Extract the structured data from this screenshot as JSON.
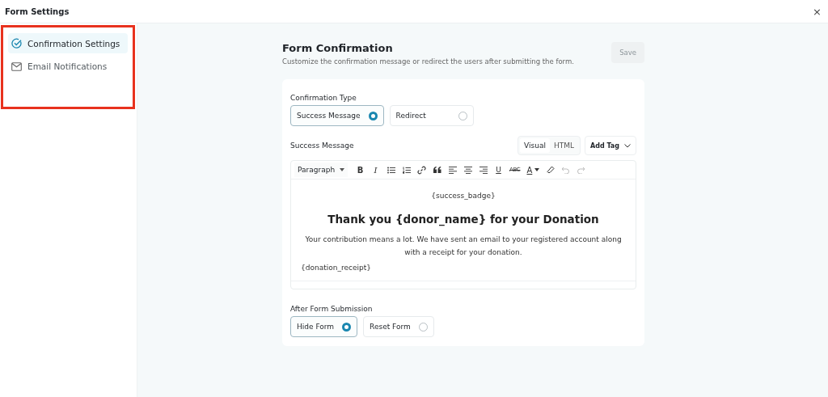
{
  "window": {
    "title": "Form Settings",
    "close": "×"
  },
  "sidebar": {
    "highlighted": true,
    "items": [
      {
        "kind": "confirmation",
        "label": "Confirmation Settings",
        "selected": true
      },
      {
        "kind": "email",
        "label": "Email Notifications",
        "selected": false
      }
    ]
  },
  "main": {
    "heading": "Form Confirmation",
    "description": "Customize the confirmation message or redirect the users after submitting the form.",
    "save": {
      "label": "Save",
      "disabled": true
    }
  },
  "confirmation_type": {
    "label": "Confirmation Type",
    "options": [
      {
        "label": "Success Message",
        "selected": true
      },
      {
        "label": "Redirect",
        "selected": false
      }
    ]
  },
  "success_message": {
    "label": "Success Message",
    "modes": [
      {
        "label": "Visual",
        "selected": true
      },
      {
        "label": "HTML",
        "selected": false
      }
    ],
    "add_tag": "Add Tag",
    "toolbar": {
      "format": "Paragraph",
      "tools": [
        {
          "kind": "bold",
          "label": "B",
          "disabled": false
        },
        {
          "kind": "italic",
          "label": "I",
          "disabled": false
        },
        {
          "kind": "bullets",
          "disabled": false
        },
        {
          "kind": "numbers",
          "disabled": false
        },
        {
          "kind": "link",
          "disabled": false
        },
        {
          "kind": "quote",
          "disabled": false
        },
        {
          "kind": "align-left",
          "disabled": false
        },
        {
          "kind": "align-center",
          "disabled": false
        },
        {
          "kind": "align-right",
          "disabled": false
        },
        {
          "kind": "underline",
          "label": "U",
          "disabled": false
        },
        {
          "kind": "strike",
          "label": "ABC",
          "disabled": false
        },
        {
          "kind": "color",
          "label": "A",
          "disabled": false
        },
        {
          "kind": "eraser",
          "disabled": false
        },
        {
          "kind": "undo",
          "disabled": true
        },
        {
          "kind": "redo",
          "disabled": true
        }
      ]
    },
    "content": {
      "badge": "{success_badge}",
      "heading": "Thank you {donor_name} for your Donation",
      "body": "Your contribution means a lot. We have sent an email to your registered account along with a receipt for your donation.",
      "receipt": "{donation_receipt}"
    }
  },
  "after_submission": {
    "label": "After Form Submission",
    "options": [
      {
        "label": "Hide Form",
        "selected": true
      },
      {
        "label": "Reset Form",
        "selected": false
      }
    ]
  }
}
